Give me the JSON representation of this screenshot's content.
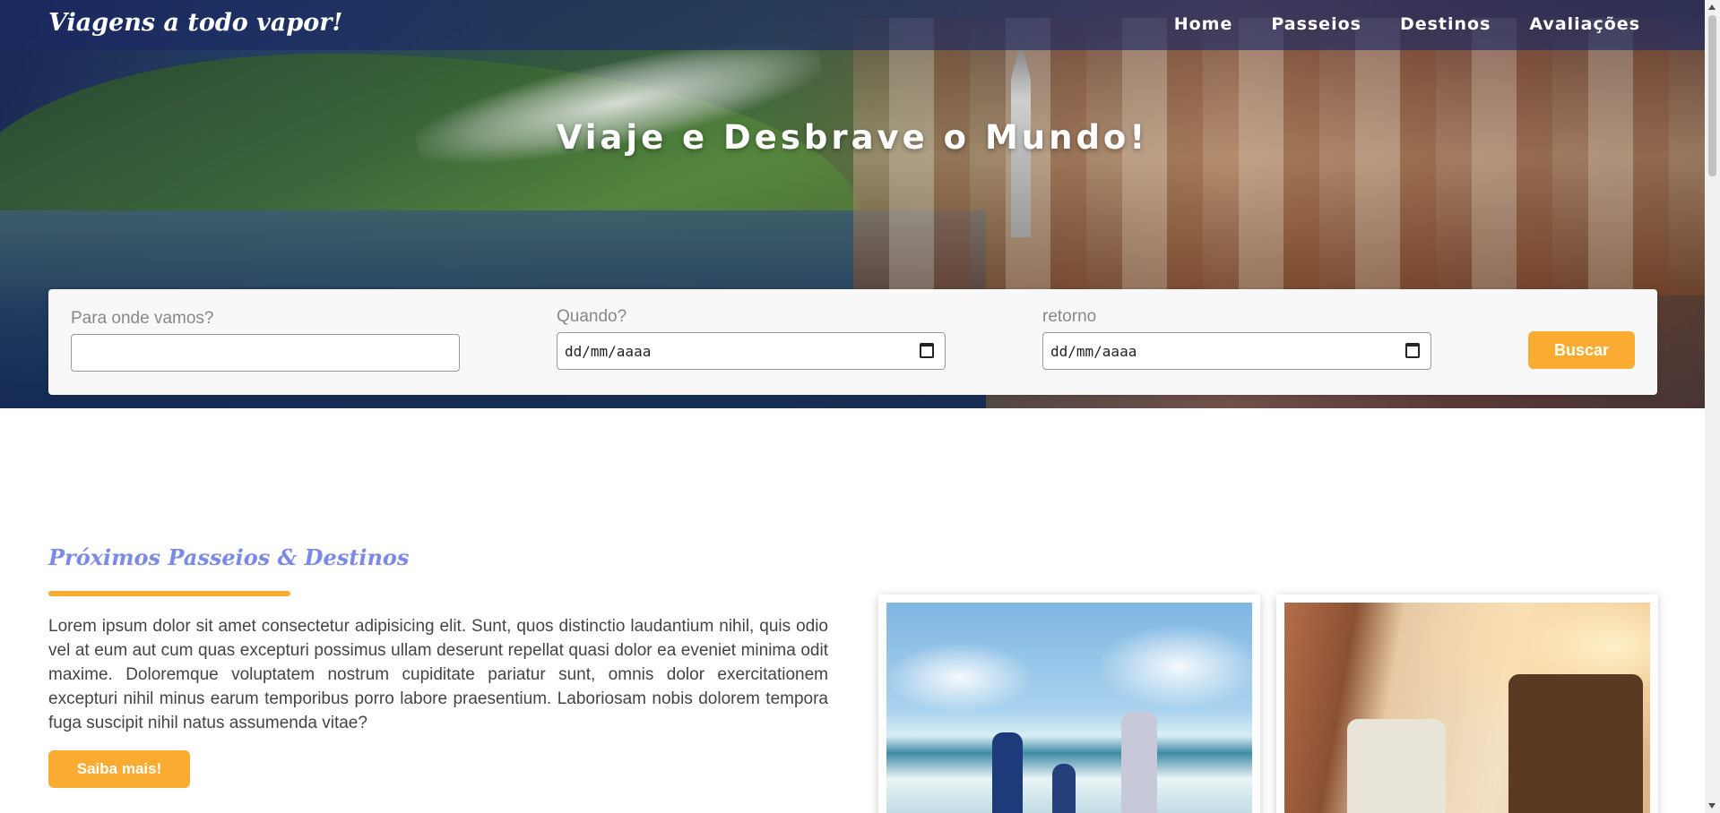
{
  "header": {
    "brand": "Viagens a todo vapor!",
    "nav": [
      "Home",
      "Passeios",
      "Destinos",
      "Avaliações"
    ]
  },
  "hero": {
    "title": "Viaje e Desbrave o Mundo!"
  },
  "search": {
    "destination_label": "Para onde vamos?",
    "destination_value": "",
    "when_label": "Quando?",
    "when_value": "dd/mm/aaaa",
    "return_label": "retorno",
    "return_value": "dd/mm/aaaa",
    "button_label": "Buscar"
  },
  "section": {
    "title": "Próximos Passeios & Destinos",
    "paragraph": "Lorem ipsum dolor sit amet consectetur adipisicing elit. Sunt, quos distinctio laudantium nihil, quis odio vel at eum aut cum quas excepturi possimus ullam deserunt repellat quasi dolor ea eveniet minima odit maxime. Doloremque voluptatem nostrum cupiditate pariatur sunt, omnis dolor exercitationem excepturi nihil minus earum temporibus porro labore praesentium. Laboriosam nobis dolorem tempora fuga suscipit nihil natus assumenda vitae?",
    "button_label": "Saiba mais!"
  },
  "colors": {
    "accent": "#f9ab32",
    "section_title": "#7a8ae6",
    "navbar": "#1c2a64"
  },
  "icons": {
    "date_picker": "calendar-icon"
  }
}
